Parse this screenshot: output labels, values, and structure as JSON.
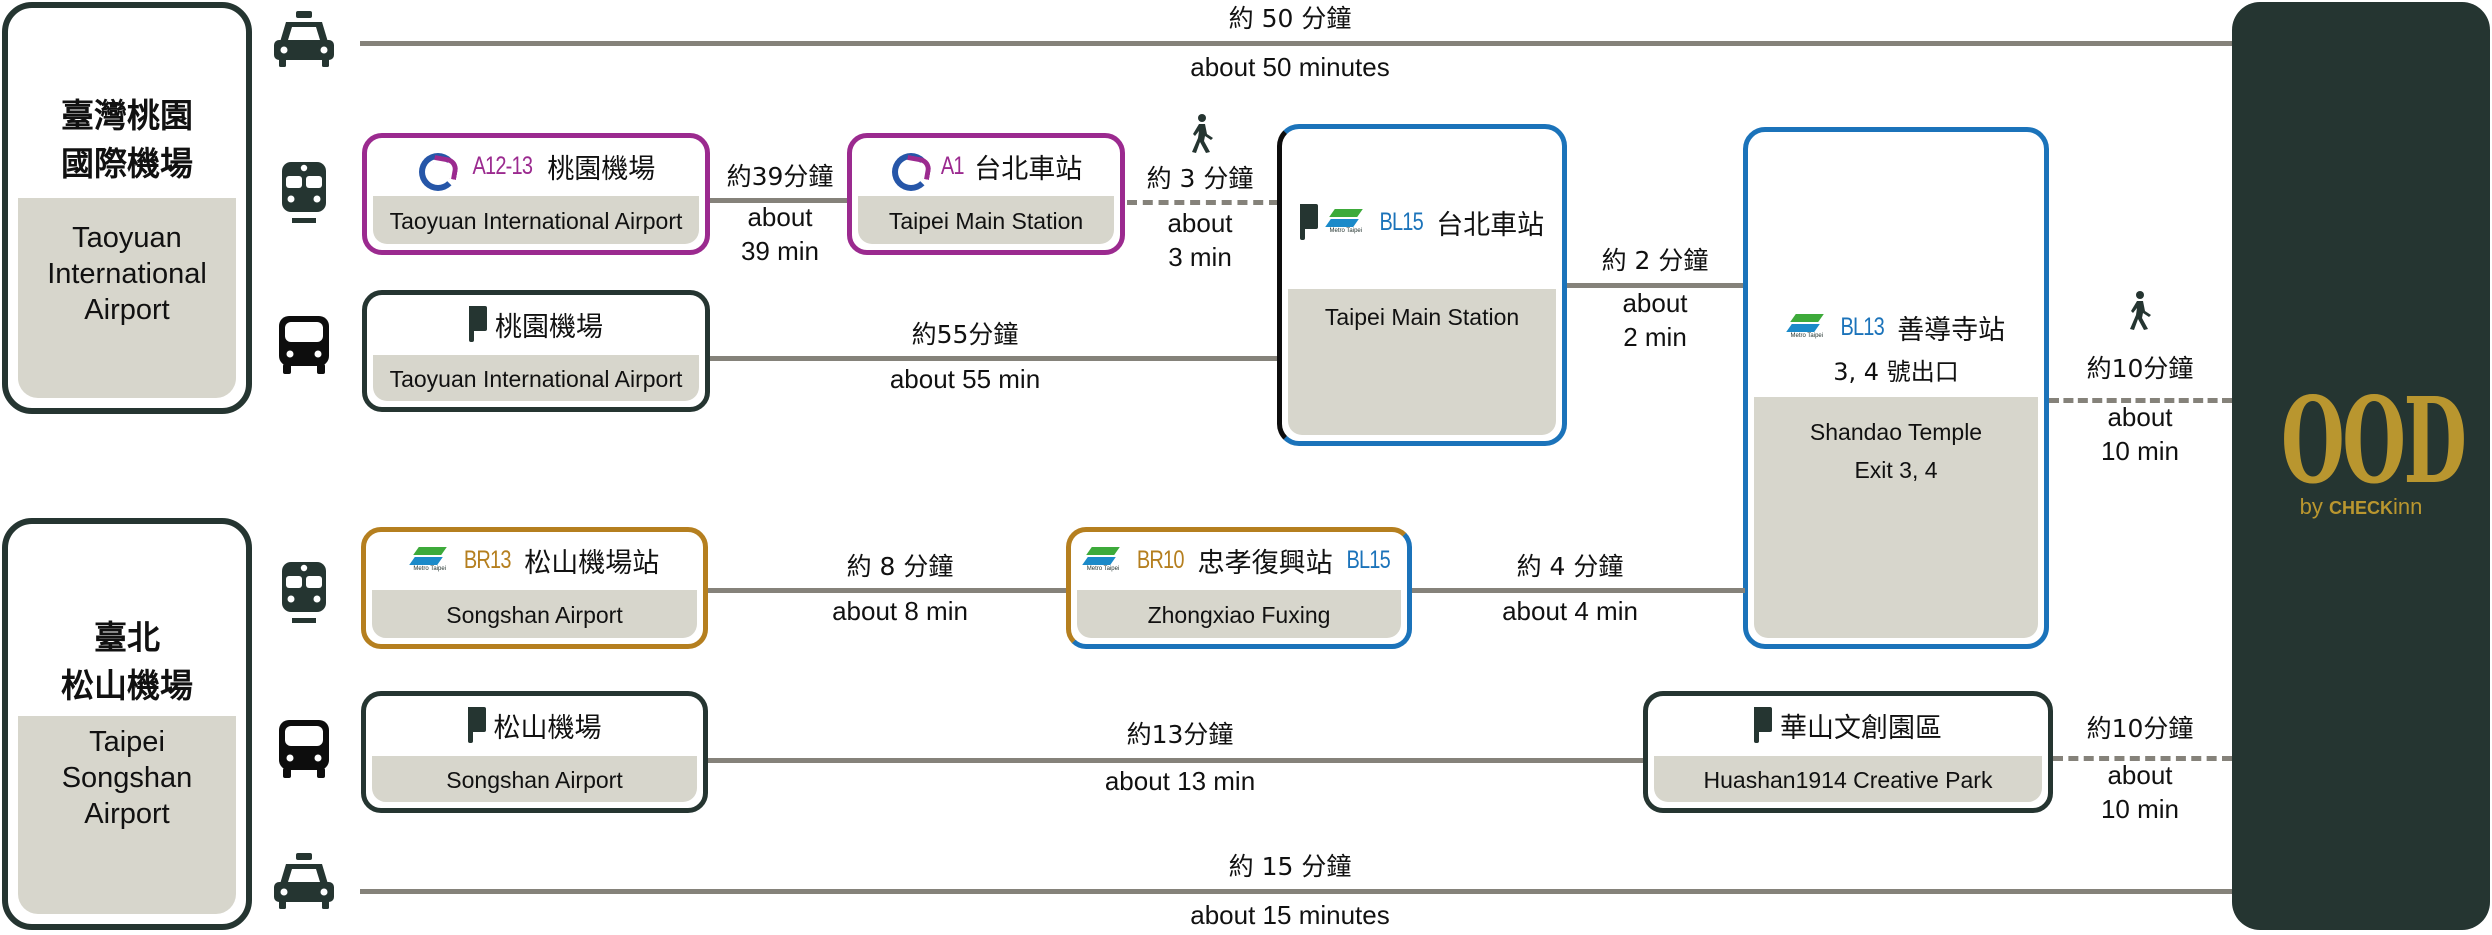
{
  "colors": {
    "dark_green": "#253531",
    "line_gray": "#85827a",
    "panel_beige": "#d7d6cc",
    "airport_mrt_purple": "#9b2a8f",
    "blue_line": "#1b73ba",
    "brown_line": "#b57f1f",
    "hotel_gold": "#b9962f"
  },
  "origins": {
    "taoyuan": {
      "zh_line1": "臺灣桃園",
      "zh_line2": "國際機場",
      "en_line1": "Taoyuan",
      "en_line2": "International",
      "en_line3": "Airport"
    },
    "songshan": {
      "zh_line1": "臺北",
      "zh_line2": "松山機場",
      "en_line1": "Taipei",
      "en_line2": "Songshan",
      "en_line3": "Airport"
    }
  },
  "routes": {
    "taoyuan_taxi": {
      "icon": "taxi-icon",
      "zh": "約 50 分鐘",
      "en": "about 50 minutes"
    },
    "taoyuan_mrt": {
      "icon": "train-icon",
      "from": {
        "logo": "airport-mrt-logo",
        "code": "A12-13",
        "zh": "桃園機場",
        "en": "Taoyuan International Airport"
      },
      "to": {
        "logo": "airport-mrt-logo",
        "code": "A1",
        "zh": "台北車站",
        "en": "Taipei Main Station"
      },
      "duration": {
        "zh": "約39分鐘",
        "en1": "about",
        "en2": "39 min"
      },
      "walk": {
        "icon": "walk-icon",
        "zh": "約 3 分鐘",
        "en1": "about",
        "en2": "3 min"
      }
    },
    "taoyuan_bus": {
      "icon": "bus-icon",
      "from": {
        "logo": "bus-stop-flag",
        "zh": "桃園機場",
        "en": "Taoyuan International Airport"
      },
      "duration": {
        "zh": "約55分鐘",
        "en": "about 55 min"
      }
    },
    "taipei_main": {
      "code": "BL15",
      "zh": "台北車站",
      "en": "Taipei Main Station"
    },
    "main_to_shandao": {
      "zh": "約 2 分鐘",
      "en1": "about",
      "en2": "2 min"
    },
    "shandao": {
      "code": "BL13",
      "zh": "善導寺站",
      "exit_zh": "3, 4 號出口",
      "en1": "Shandao Temple",
      "en2": "Exit 3, 4"
    },
    "shandao_walk": {
      "icon": "walk-icon",
      "zh": "約10分鐘",
      "en1": "about",
      "en2": "10 min"
    },
    "songshan_mrt": {
      "icon": "train-icon",
      "from": {
        "code": "BR13",
        "zh": "松山機場站",
        "en": "Songshan Airport"
      },
      "duration1": {
        "zh": "約 8 分鐘",
        "en": "about 8 min"
      },
      "transfer": {
        "code_left": "BR10",
        "zh": "忠孝復興站",
        "code_right": "BL15",
        "en": "Zhongxiao Fuxing"
      },
      "duration2": {
        "zh": "約 4 分鐘",
        "en": "about 4 min"
      }
    },
    "songshan_bus": {
      "icon": "bus-icon",
      "from": {
        "zh": "松山機場",
        "en": "Songshan Airport"
      },
      "duration": {
        "zh": "約13分鐘",
        "en": "about 13 min"
      },
      "to": {
        "zh": "華山文創園區",
        "en": "Huashan1914 Creative Park"
      },
      "walk": {
        "zh": "約10分鐘",
        "en1": "about",
        "en2": "10 min"
      }
    },
    "songshan_taxi": {
      "icon": "taxi-icon",
      "zh": "約 15 分鐘",
      "en": "about 15 minutes"
    }
  },
  "metro_logo_text": "Metro Taipei",
  "hotel": {
    "logo": "OOD",
    "by": "by",
    "brand_a": "CHECK",
    "brand_b": "inn"
  }
}
